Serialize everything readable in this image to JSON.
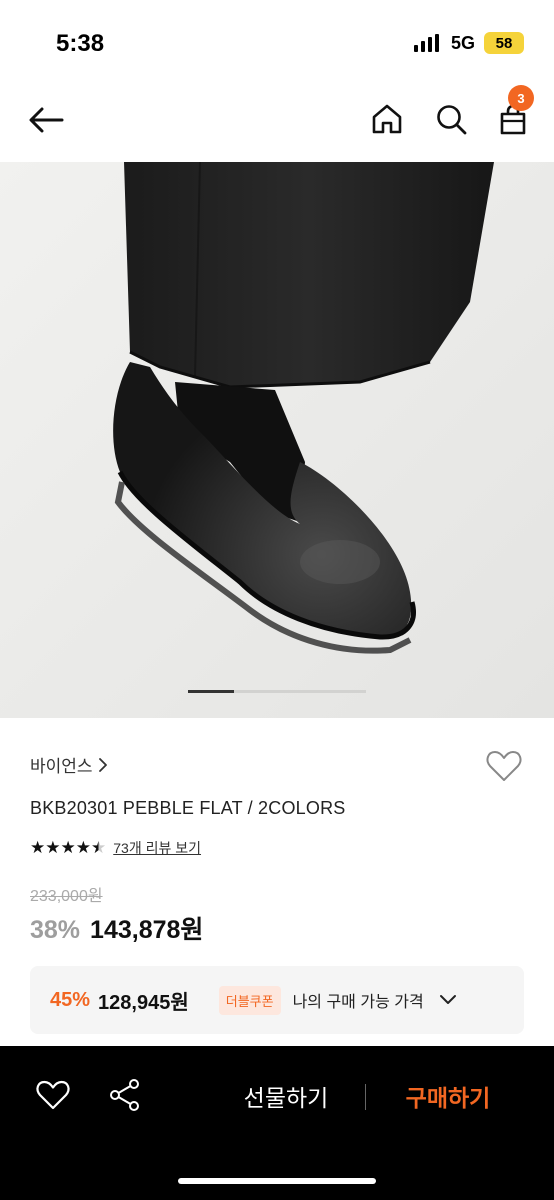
{
  "status_bar": {
    "time": "5:38",
    "network": "5G",
    "battery": "58"
  },
  "nav": {
    "icons": [
      "back-arrow-icon",
      "home-icon",
      "search-icon",
      "shopping-bag-icon"
    ],
    "cart_count": "3"
  },
  "product": {
    "image_alt": "black leather flat shoe",
    "carousel": {
      "count": 3,
      "active": 0
    },
    "brand": "바이언스",
    "title": "BKB20301 PEBBLE FLAT / 2COLORS",
    "rating": 4.5,
    "review_link": "73개 리뷰 보기",
    "original_price": "233,000원",
    "discount_rate": "38%",
    "price": "143,878원"
  },
  "coupon": {
    "discount_rate": "45%",
    "price": "128,945원",
    "badge": "더블쿠폰",
    "label": "나의 구매 가능 가격"
  },
  "bottom_bar": {
    "gift_label": "선물하기",
    "buy_label": "구매하기"
  },
  "colors": {
    "accent": "#f26722",
    "bottom_bar": "#000000"
  }
}
